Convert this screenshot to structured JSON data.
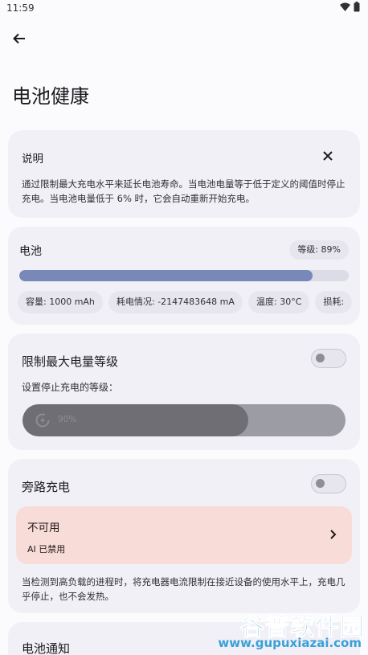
{
  "status_bar": {
    "time": "11:59"
  },
  "header": {
    "title": "电池健康"
  },
  "info_card": {
    "title": "说明",
    "text": "通过限制最大充电水平来延长电池寿命。当电池电量等于低于定义的阈值时停止充电。当电池电量低于 6% 时，它会自动重新开始充电。"
  },
  "battery_card": {
    "title": "电池",
    "level_label": "等级: 89%",
    "level_fraction": 0.89,
    "chips": [
      "容量: 1000 mAh",
      "耗电情况: -2147483648 mA",
      "温度: 30°C",
      "损耗: "
    ]
  },
  "limit_card": {
    "title": "限制最大电量等级",
    "toggle_on": false,
    "subtitle": "设置停止充电的等级：",
    "slider_label": "90%",
    "slider_fraction": 0.7
  },
  "bypass_card": {
    "title": "旁路充电",
    "toggle_on": false,
    "unavailable_title": "不可用",
    "unavailable_sub": "AI 已禁用",
    "text": "当检测到高负载的进程时，将充电器电流限制在接近设备的使用水平上，充电几乎停止，也不会发热。"
  },
  "notify_card": {
    "title": "电池通知"
  },
  "watermark": {
    "main": "谷普软件园",
    "url": "www.gupuxiazai.com"
  },
  "colors": {
    "background": "#fbfbfe",
    "card": "#f1f0f7",
    "battery_fill": "#7888b8",
    "unavailable_bg": "#f8dcd8",
    "watermark": "#3aa0d8"
  }
}
